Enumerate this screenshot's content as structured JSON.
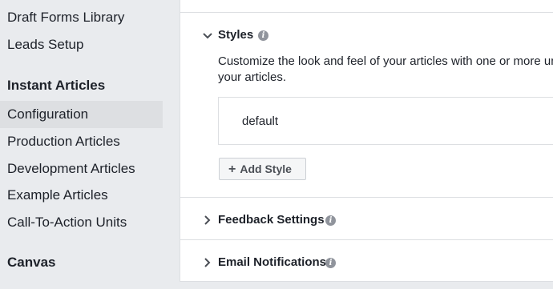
{
  "sidebar": {
    "items_top": [
      "Draft Forms Library",
      "Leads Setup"
    ],
    "heading_instant": "Instant Articles",
    "items_instant": [
      "Configuration",
      "Production Articles",
      "Development Articles",
      "Example Articles",
      "Call-To-Action Units"
    ],
    "active_item": "Configuration",
    "heading_canvas": "Canvas"
  },
  "styles_section": {
    "title": "Styles",
    "expanded": true,
    "description_line1": "Customize the look and feel of your articles with one or more un",
    "description_line2": "your articles.",
    "styles": [
      "default"
    ],
    "add_button_label": "Add Style"
  },
  "feedback_section": {
    "title": "Feedback Settings",
    "expanded": false
  },
  "email_section": {
    "title": "Email Notifications",
    "expanded": false
  },
  "colors": {
    "bg": "#e9ebee",
    "active": "#dddfe2",
    "text": "#1d2129",
    "info": "#90949c"
  }
}
